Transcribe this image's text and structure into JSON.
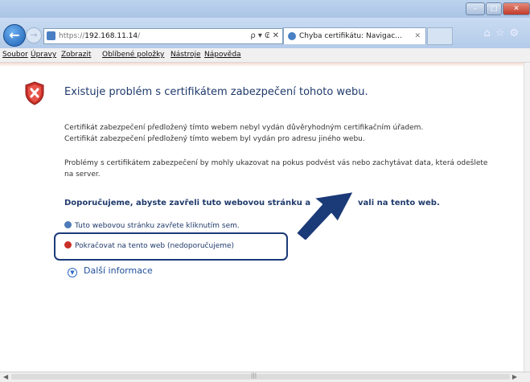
{
  "window": {
    "controls": [
      "–",
      "□",
      "✕"
    ]
  },
  "nav": {
    "url_prefix": "https://",
    "url_host": "192.168.11.14",
    "url_suffix": "/",
    "address_controls": "ρ ▾ ₢ ✕",
    "tab_title": "Chyba certifikátu: Navigac...",
    "tab_close": "✕",
    "toolbar_icons": "⌂☆⚙"
  },
  "menu": [
    "Soubor",
    "Úpravy",
    "Zobrazit",
    "Oblíbené položky",
    "Nástroje",
    "Nápověda"
  ],
  "page": {
    "heading": "Existuje problém s certifikátem zabezpečení tohoto webu.",
    "para1_line1": "Certifikát zabezpečení předložený tímto webem nebyl vydán důvěryhodným certifikačním úřadem.",
    "para1_line2": "Certifikát zabezpečení předložený tímto webem byl vydán pro adresu jiného webu.",
    "para2": "Problémy s certifikátem zabezpečení by mohly ukazovat na pokus podvést vás nebo zachytávat data, která odešlete na server.",
    "recommend_a": "Doporučujeme, abyste zavřeli tuto webovou stránku a",
    "recommend_b": "vali na tento web.",
    "close_link": "Tuto webovou stránku zavřete kliknutím sem.",
    "continue_link": "Pokračovat na tento web (nedoporučujeme)",
    "more_info": "Další informace"
  },
  "colors": {
    "accent": "#1b3a78",
    "link": "#1f3a6b",
    "warning": "#c8302a"
  }
}
